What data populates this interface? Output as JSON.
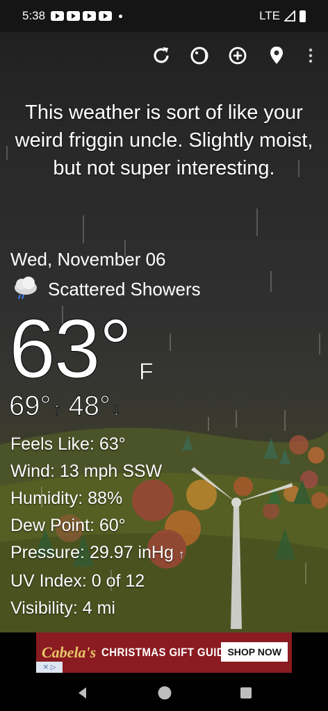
{
  "status_bar": {
    "time": "5:38",
    "network": "LTE",
    "notification_icons": [
      "youtube-icon",
      "youtube-icon",
      "youtube-icon",
      "youtube-icon"
    ]
  },
  "toolbar": {
    "icons": [
      "refresh-icon",
      "theme-icon",
      "add-location-icon",
      "location-pin-icon",
      "overflow-menu-icon"
    ]
  },
  "quote": "This weather is sort of like your weird friggin uncle. Slightly moist, but not super interesting.",
  "weather": {
    "date": "Wed, November 06",
    "condition": "Scattered Showers",
    "condition_icon": "cloud-rain-icon",
    "temperature": "63°",
    "unit": "F",
    "high": "69°",
    "low": "48°",
    "details": [
      {
        "label": "Feels Like:",
        "value": "63°"
      },
      {
        "label": "Wind:",
        "value": "13 mph SSW"
      },
      {
        "label": "Humidity:",
        "value": "88%"
      },
      {
        "label": "Dew Point:",
        "value": "60°"
      },
      {
        "label": "Pressure:",
        "value": "29.97 inHg"
      },
      {
        "label": "UV Index:",
        "value": "0 of 12"
      },
      {
        "label": "Visibility:",
        "value": "4 mi"
      }
    ]
  },
  "ad": {
    "brand": "Cabela's",
    "text": "CHRISTMAS GIFT GUIDE",
    "button": "SHOP NOW"
  },
  "nav": {
    "icons": [
      "back-icon",
      "home-icon",
      "recents-icon"
    ]
  },
  "colors": {
    "ad_background": "#8a1b20",
    "ad_brand": "#e9c66b"
  }
}
